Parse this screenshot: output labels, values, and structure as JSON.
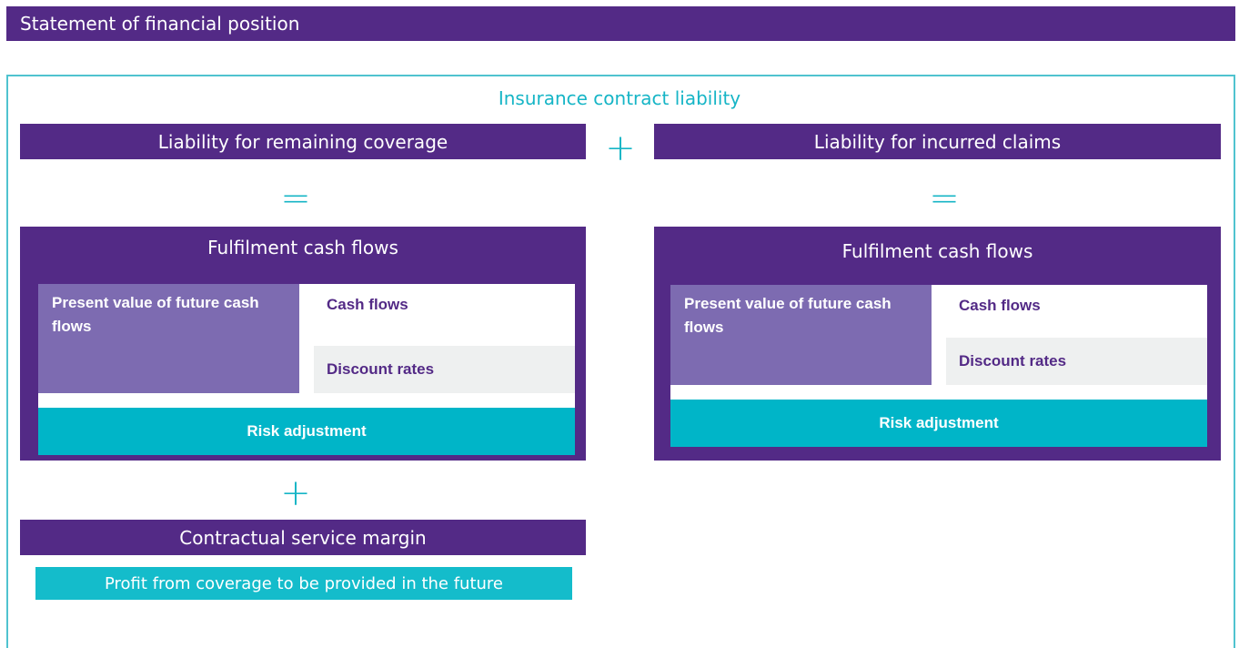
{
  "header": {
    "title": "Statement of financial position"
  },
  "diagram": {
    "title": "Insurance contract liability",
    "lrc": {
      "label": "Liability for remaining coverage"
    },
    "lic": {
      "label": "Liability for incurred claims"
    },
    "operators": {
      "plus": "+",
      "equals": "="
    },
    "left_panel": {
      "title": "Fulfilment cash flows",
      "pv": "Present value of future cash flows",
      "cash_flows": "Cash flows",
      "discount_rates": "Discount rates",
      "risk_adjustment": "Risk adjustment"
    },
    "right_panel": {
      "title": "Fulfilment cash flows",
      "pv": "Present value of future cash flows",
      "cash_flows": "Cash flows",
      "discount_rates": "Discount rates",
      "risk_adjustment": "Risk adjustment"
    },
    "csm": {
      "label": "Contractual service margin",
      "sub": "Profit from coverage to be provided in the future"
    }
  },
  "colors": {
    "purple": "#532a86",
    "teal": "#00b5c8",
    "lavender": "#7d6bb1",
    "light_gray": "#eef0f0"
  }
}
